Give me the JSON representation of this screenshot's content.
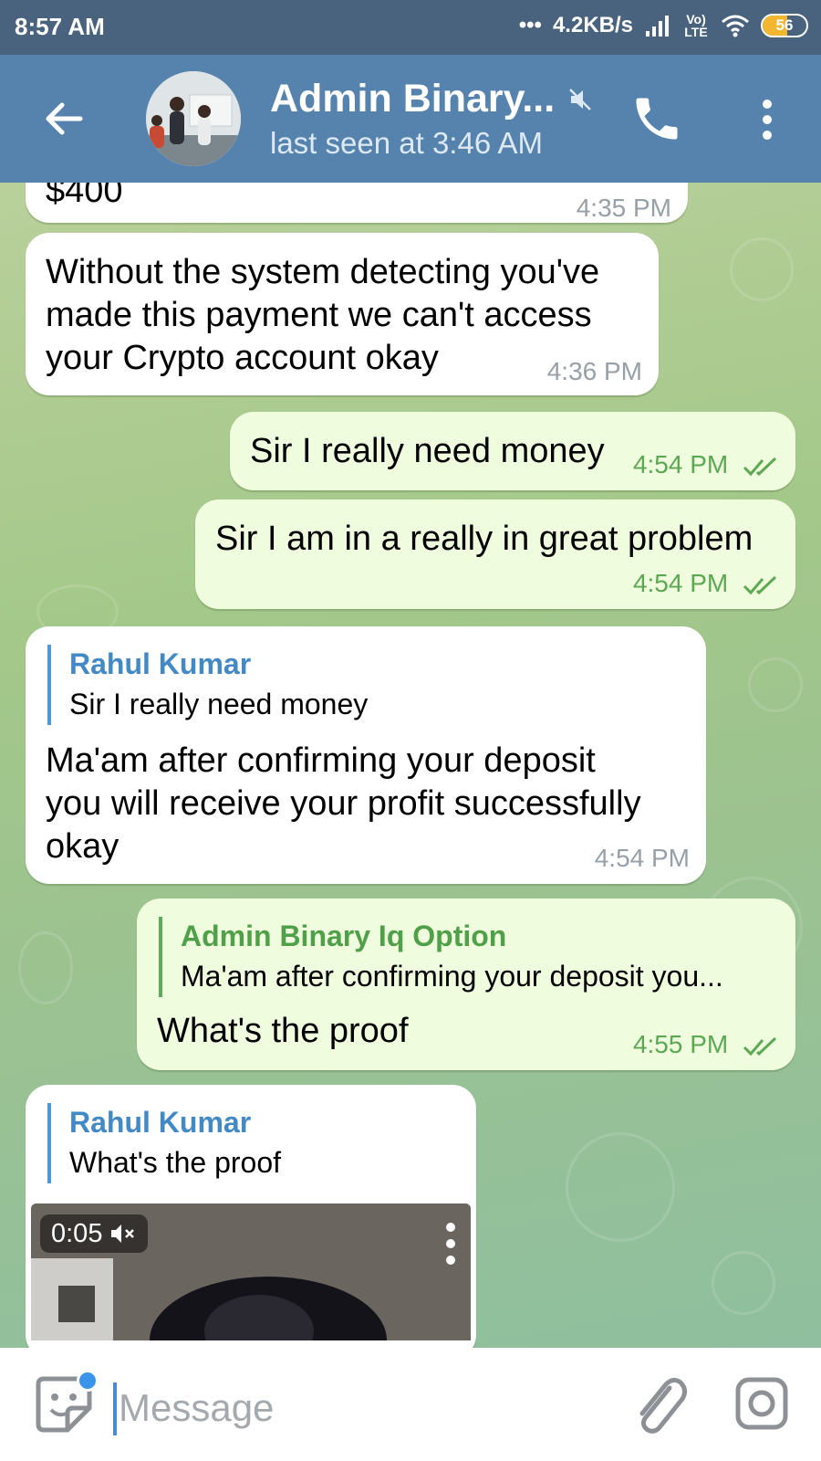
{
  "status_bar": {
    "time": "8:57 AM",
    "network_speed": "4.2KB/s",
    "network_type": "Vo) LTE",
    "battery_level": "56",
    "battery_fraction": 0.56
  },
  "header": {
    "title": "Admin Binary...",
    "subtitle": "last seen at 3:46 AM",
    "icons": [
      "back-arrow-icon",
      "avatar",
      "muted-icon",
      "phone-icon",
      "more-vert-icon"
    ]
  },
  "messages": [
    {
      "direction": "in",
      "text": "$400",
      "time": "4:35 PM"
    },
    {
      "direction": "in",
      "text": [
        "Without the system detecting you've",
        "made this payment we can't access",
        "your Crypto account okay"
      ],
      "time": "4:36 PM"
    },
    {
      "direction": "out",
      "text": "Sir I really need money",
      "time": "4:54 PM",
      "read": true
    },
    {
      "direction": "out",
      "text": "Sir I am in a really in great problem",
      "time": "4:54 PM",
      "read": true
    },
    {
      "direction": "in",
      "reply_to": {
        "name": "Rahul Kumar",
        "text": "Sir I really need money"
      },
      "text": [
        "Ma'am after confirming your deposit",
        "you will receive your profit successfully",
        "okay"
      ],
      "time": "4:54 PM"
    },
    {
      "direction": "out",
      "reply_to": {
        "name": "Admin Binary Iq Option",
        "text": "Ma'am after confirming your deposit you..."
      },
      "text": "What's the proof",
      "time": "4:55 PM",
      "read": true
    },
    {
      "direction": "in",
      "reply_to": {
        "name": "Rahul Kumar",
        "text": "What's the proof"
      },
      "video": {
        "duration": "0:05",
        "muted": true
      }
    }
  ],
  "input": {
    "placeholder": "Message"
  },
  "colors": {
    "status_bar": "#49627e",
    "header": "#5683ad",
    "incoming_bubble": "#ffffff",
    "outgoing_bubble": "#effdde",
    "read_ticks": "#5ca853",
    "reply_name_in": "#4389c5",
    "reply_name_out": "#4fa048"
  }
}
